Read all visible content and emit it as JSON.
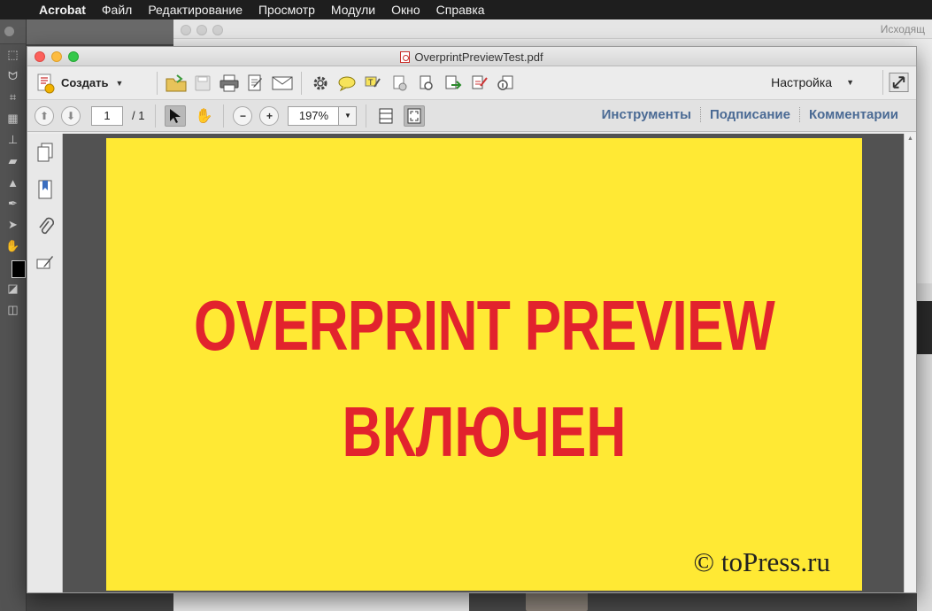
{
  "menubar": {
    "app": "Acrobat",
    "items": [
      "Файл",
      "Редактирование",
      "Просмотр",
      "Модули",
      "Окно",
      "Справка"
    ]
  },
  "background_window": {
    "title_fragment": "Исходящ"
  },
  "window": {
    "title": "OverprintPreviewTest.pdf"
  },
  "toolbar": {
    "create_label": "Создать",
    "customize_label": "Настройка"
  },
  "nav": {
    "current_page": "1",
    "total_pages": "/ 1",
    "zoom": "197%"
  },
  "panes": {
    "tools": "Инструменты",
    "sign": "Подписание",
    "comments": "Комментарии"
  },
  "document": {
    "line1": "OVERPRINT PREVIEW",
    "line2": "ВКЛЮЧЕН",
    "copyright": "© toPress.ru",
    "page_color": "#ffe934",
    "text_color": "#e2232d"
  }
}
